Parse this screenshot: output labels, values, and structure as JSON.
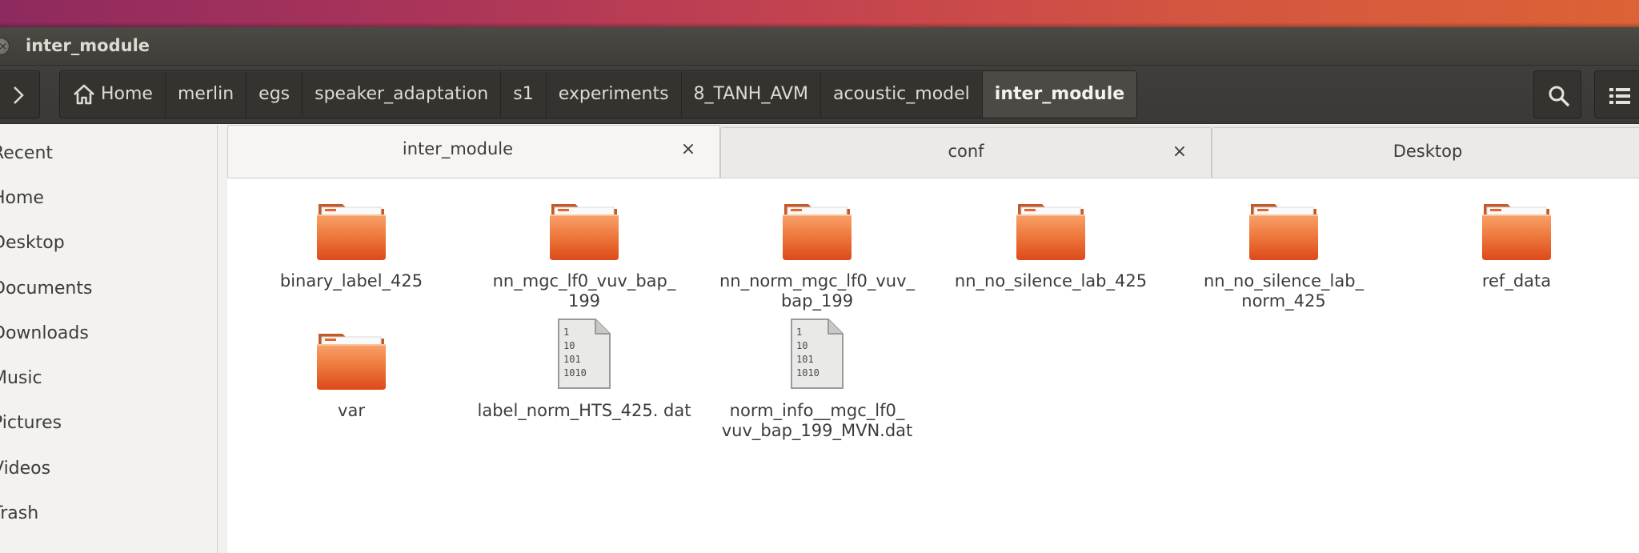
{
  "window": {
    "title": "inter_module"
  },
  "toolbar": {
    "breadcrumbs": [
      {
        "label": "Home"
      },
      {
        "label": "merlin"
      },
      {
        "label": "egs"
      },
      {
        "label": "speaker_adaptation"
      },
      {
        "label": "s1"
      },
      {
        "label": "experiments"
      },
      {
        "label": "8_TANH_AVM"
      },
      {
        "label": "acoustic_model"
      },
      {
        "label": "inter_module"
      }
    ]
  },
  "sidebar": {
    "items": [
      {
        "label": "Recent"
      },
      {
        "label": "Home"
      },
      {
        "label": "Desktop"
      },
      {
        "label": "Documents"
      },
      {
        "label": "Downloads"
      },
      {
        "label": "Music"
      },
      {
        "label": "Pictures"
      },
      {
        "label": "Videos"
      },
      {
        "label": "Trash"
      }
    ]
  },
  "tabs": [
    {
      "label": "inter_module",
      "close": "×"
    },
    {
      "label": "conf",
      "close": "×"
    },
    {
      "label": "Desktop"
    }
  ],
  "files": [
    {
      "name": "binary_label_425",
      "type": "folder"
    },
    {
      "name": "nn_mgc_lf0_vuv_bap_ 199",
      "type": "folder"
    },
    {
      "name": "nn_norm_mgc_lf0_vuv_ bap_199",
      "type": "folder"
    },
    {
      "name": "nn_no_silence_lab_425",
      "type": "folder"
    },
    {
      "name": "nn_no_silence_lab_ norm_425",
      "type": "folder"
    },
    {
      "name": "ref_data",
      "type": "folder"
    },
    {
      "name": "var",
      "type": "folder"
    },
    {
      "name": "label_norm_HTS_425. dat",
      "type": "binary-file"
    },
    {
      "name": "norm_info__mgc_lf0_ vuv_bap_199_MVN.dat",
      "type": "binary-file"
    }
  ],
  "binary_icon_lines": [
    "1",
    "10",
    "101",
    "1010"
  ],
  "colors": {
    "folder_top": "#f4a366",
    "folder_body": "#e8622a",
    "accent": "#dd4814"
  }
}
